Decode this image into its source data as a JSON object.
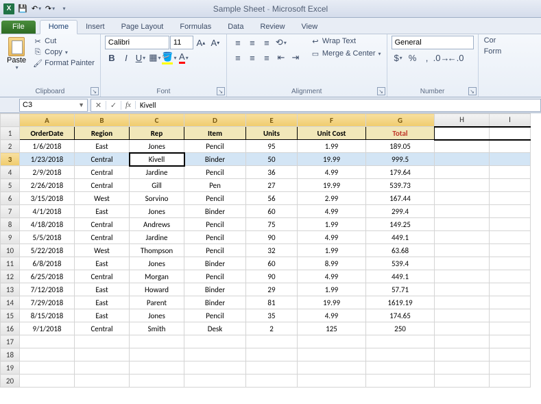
{
  "app": {
    "doc": "Sample Sheet",
    "product": "Microsoft Excel"
  },
  "tabs": {
    "file": "File",
    "home": "Home",
    "insert": "Insert",
    "page_layout": "Page Layout",
    "formulas": "Formulas",
    "data": "Data",
    "review": "Review",
    "view": "View"
  },
  "clipboard": {
    "paste": "Paste",
    "cut": "Cut",
    "copy": "Copy",
    "format_painter": "Format Painter",
    "label": "Clipboard"
  },
  "font": {
    "name": "Calibri",
    "size": "11",
    "label": "Font"
  },
  "alignment": {
    "wrap": "Wrap Text",
    "merge": "Merge & Center",
    "label": "Alignment"
  },
  "number": {
    "format": "General",
    "label": "Number"
  },
  "cells_partial": {
    "cond": "Cor",
    "fmt": "Form"
  },
  "namebox": "C3",
  "formula": "Kivell",
  "columns": [
    "A",
    "B",
    "C",
    "D",
    "E",
    "F",
    "G",
    "H",
    "I"
  ],
  "col_widths": [
    "col-a",
    "col-b",
    "col-c",
    "col-d",
    "col-e",
    "col-f",
    "col-g",
    "col-h",
    "col-i"
  ],
  "selected_col_idx": [
    0,
    1,
    2,
    3,
    4,
    5,
    6
  ],
  "selected_row": 3,
  "headers": [
    "OrderDate",
    "Region",
    "Rep",
    "Item",
    "Units",
    "Unit Cost",
    "Total"
  ],
  "rows": [
    [
      "1/6/2018",
      "East",
      "Jones",
      "Pencil",
      "95",
      "1.99",
      "189.05"
    ],
    [
      "1/23/2018",
      "Central",
      "Kivell",
      "Binder",
      "50",
      "19.99",
      "999.5"
    ],
    [
      "2/9/2018",
      "Central",
      "Jardine",
      "Pencil",
      "36",
      "4.99",
      "179.64"
    ],
    [
      "2/26/2018",
      "Central",
      "Gill",
      "Pen",
      "27",
      "19.99",
      "539.73"
    ],
    [
      "3/15/2018",
      "West",
      "Sorvino",
      "Pencil",
      "56",
      "2.99",
      "167.44"
    ],
    [
      "4/1/2018",
      "East",
      "Jones",
      "Binder",
      "60",
      "4.99",
      "299.4"
    ],
    [
      "4/18/2018",
      "Central",
      "Andrews",
      "Pencil",
      "75",
      "1.99",
      "149.25"
    ],
    [
      "5/5/2018",
      "Central",
      "Jardine",
      "Pencil",
      "90",
      "4.99",
      "449.1"
    ],
    [
      "5/22/2018",
      "West",
      "Thompson",
      "Pencil",
      "32",
      "1.99",
      "63.68"
    ],
    [
      "6/8/2018",
      "East",
      "Jones",
      "Binder",
      "60",
      "8.99",
      "539.4"
    ],
    [
      "6/25/2018",
      "Central",
      "Morgan",
      "Pencil",
      "90",
      "4.99",
      "449.1"
    ],
    [
      "7/12/2018",
      "East",
      "Howard",
      "Binder",
      "29",
      "1.99",
      "57.71"
    ],
    [
      "7/29/2018",
      "East",
      "Parent",
      "Binder",
      "81",
      "19.99",
      "1619.19"
    ],
    [
      "8/15/2018",
      "East",
      "Jones",
      "Pencil",
      "35",
      "4.99",
      "174.65"
    ],
    [
      "9/1/2018",
      "Central",
      "Smith",
      "Desk",
      "2",
      "125",
      "250"
    ]
  ],
  "empty_rows": [
    17,
    18,
    19,
    20
  ],
  "chart_data": {
    "type": "table",
    "title": "Sample Sheet",
    "columns": [
      "OrderDate",
      "Region",
      "Rep",
      "Item",
      "Units",
      "Unit Cost",
      "Total"
    ],
    "records": [
      {
        "OrderDate": "1/6/2018",
        "Region": "East",
        "Rep": "Jones",
        "Item": "Pencil",
        "Units": 95,
        "Unit Cost": 1.99,
        "Total": 189.05
      },
      {
        "OrderDate": "1/23/2018",
        "Region": "Central",
        "Rep": "Kivell",
        "Item": "Binder",
        "Units": 50,
        "Unit Cost": 19.99,
        "Total": 999.5
      },
      {
        "OrderDate": "2/9/2018",
        "Region": "Central",
        "Rep": "Jardine",
        "Item": "Pencil",
        "Units": 36,
        "Unit Cost": 4.99,
        "Total": 179.64
      },
      {
        "OrderDate": "2/26/2018",
        "Region": "Central",
        "Rep": "Gill",
        "Item": "Pen",
        "Units": 27,
        "Unit Cost": 19.99,
        "Total": 539.73
      },
      {
        "OrderDate": "3/15/2018",
        "Region": "West",
        "Rep": "Sorvino",
        "Item": "Pencil",
        "Units": 56,
        "Unit Cost": 2.99,
        "Total": 167.44
      },
      {
        "OrderDate": "4/1/2018",
        "Region": "East",
        "Rep": "Jones",
        "Item": "Binder",
        "Units": 60,
        "Unit Cost": 4.99,
        "Total": 299.4
      },
      {
        "OrderDate": "4/18/2018",
        "Region": "Central",
        "Rep": "Andrews",
        "Item": "Pencil",
        "Units": 75,
        "Unit Cost": 1.99,
        "Total": 149.25
      },
      {
        "OrderDate": "5/5/2018",
        "Region": "Central",
        "Rep": "Jardine",
        "Item": "Pencil",
        "Units": 90,
        "Unit Cost": 4.99,
        "Total": 449.1
      },
      {
        "OrderDate": "5/22/2018",
        "Region": "West",
        "Rep": "Thompson",
        "Item": "Pencil",
        "Units": 32,
        "Unit Cost": 1.99,
        "Total": 63.68
      },
      {
        "OrderDate": "6/8/2018",
        "Region": "East",
        "Rep": "Jones",
        "Item": "Binder",
        "Units": 60,
        "Unit Cost": 8.99,
        "Total": 539.4
      },
      {
        "OrderDate": "6/25/2018",
        "Region": "Central",
        "Rep": "Morgan",
        "Item": "Pencil",
        "Units": 90,
        "Unit Cost": 4.99,
        "Total": 449.1
      },
      {
        "OrderDate": "7/12/2018",
        "Region": "East",
        "Rep": "Howard",
        "Item": "Binder",
        "Units": 29,
        "Unit Cost": 1.99,
        "Total": 57.71
      },
      {
        "OrderDate": "7/29/2018",
        "Region": "East",
        "Rep": "Parent",
        "Item": "Binder",
        "Units": 81,
        "Unit Cost": 19.99,
        "Total": 1619.19
      },
      {
        "OrderDate": "8/15/2018",
        "Region": "East",
        "Rep": "Jones",
        "Item": "Pencil",
        "Units": 35,
        "Unit Cost": 4.99,
        "Total": 174.65
      },
      {
        "OrderDate": "9/1/2018",
        "Region": "Central",
        "Rep": "Smith",
        "Item": "Desk",
        "Units": 2,
        "Unit Cost": 125,
        "Total": 250
      }
    ]
  }
}
